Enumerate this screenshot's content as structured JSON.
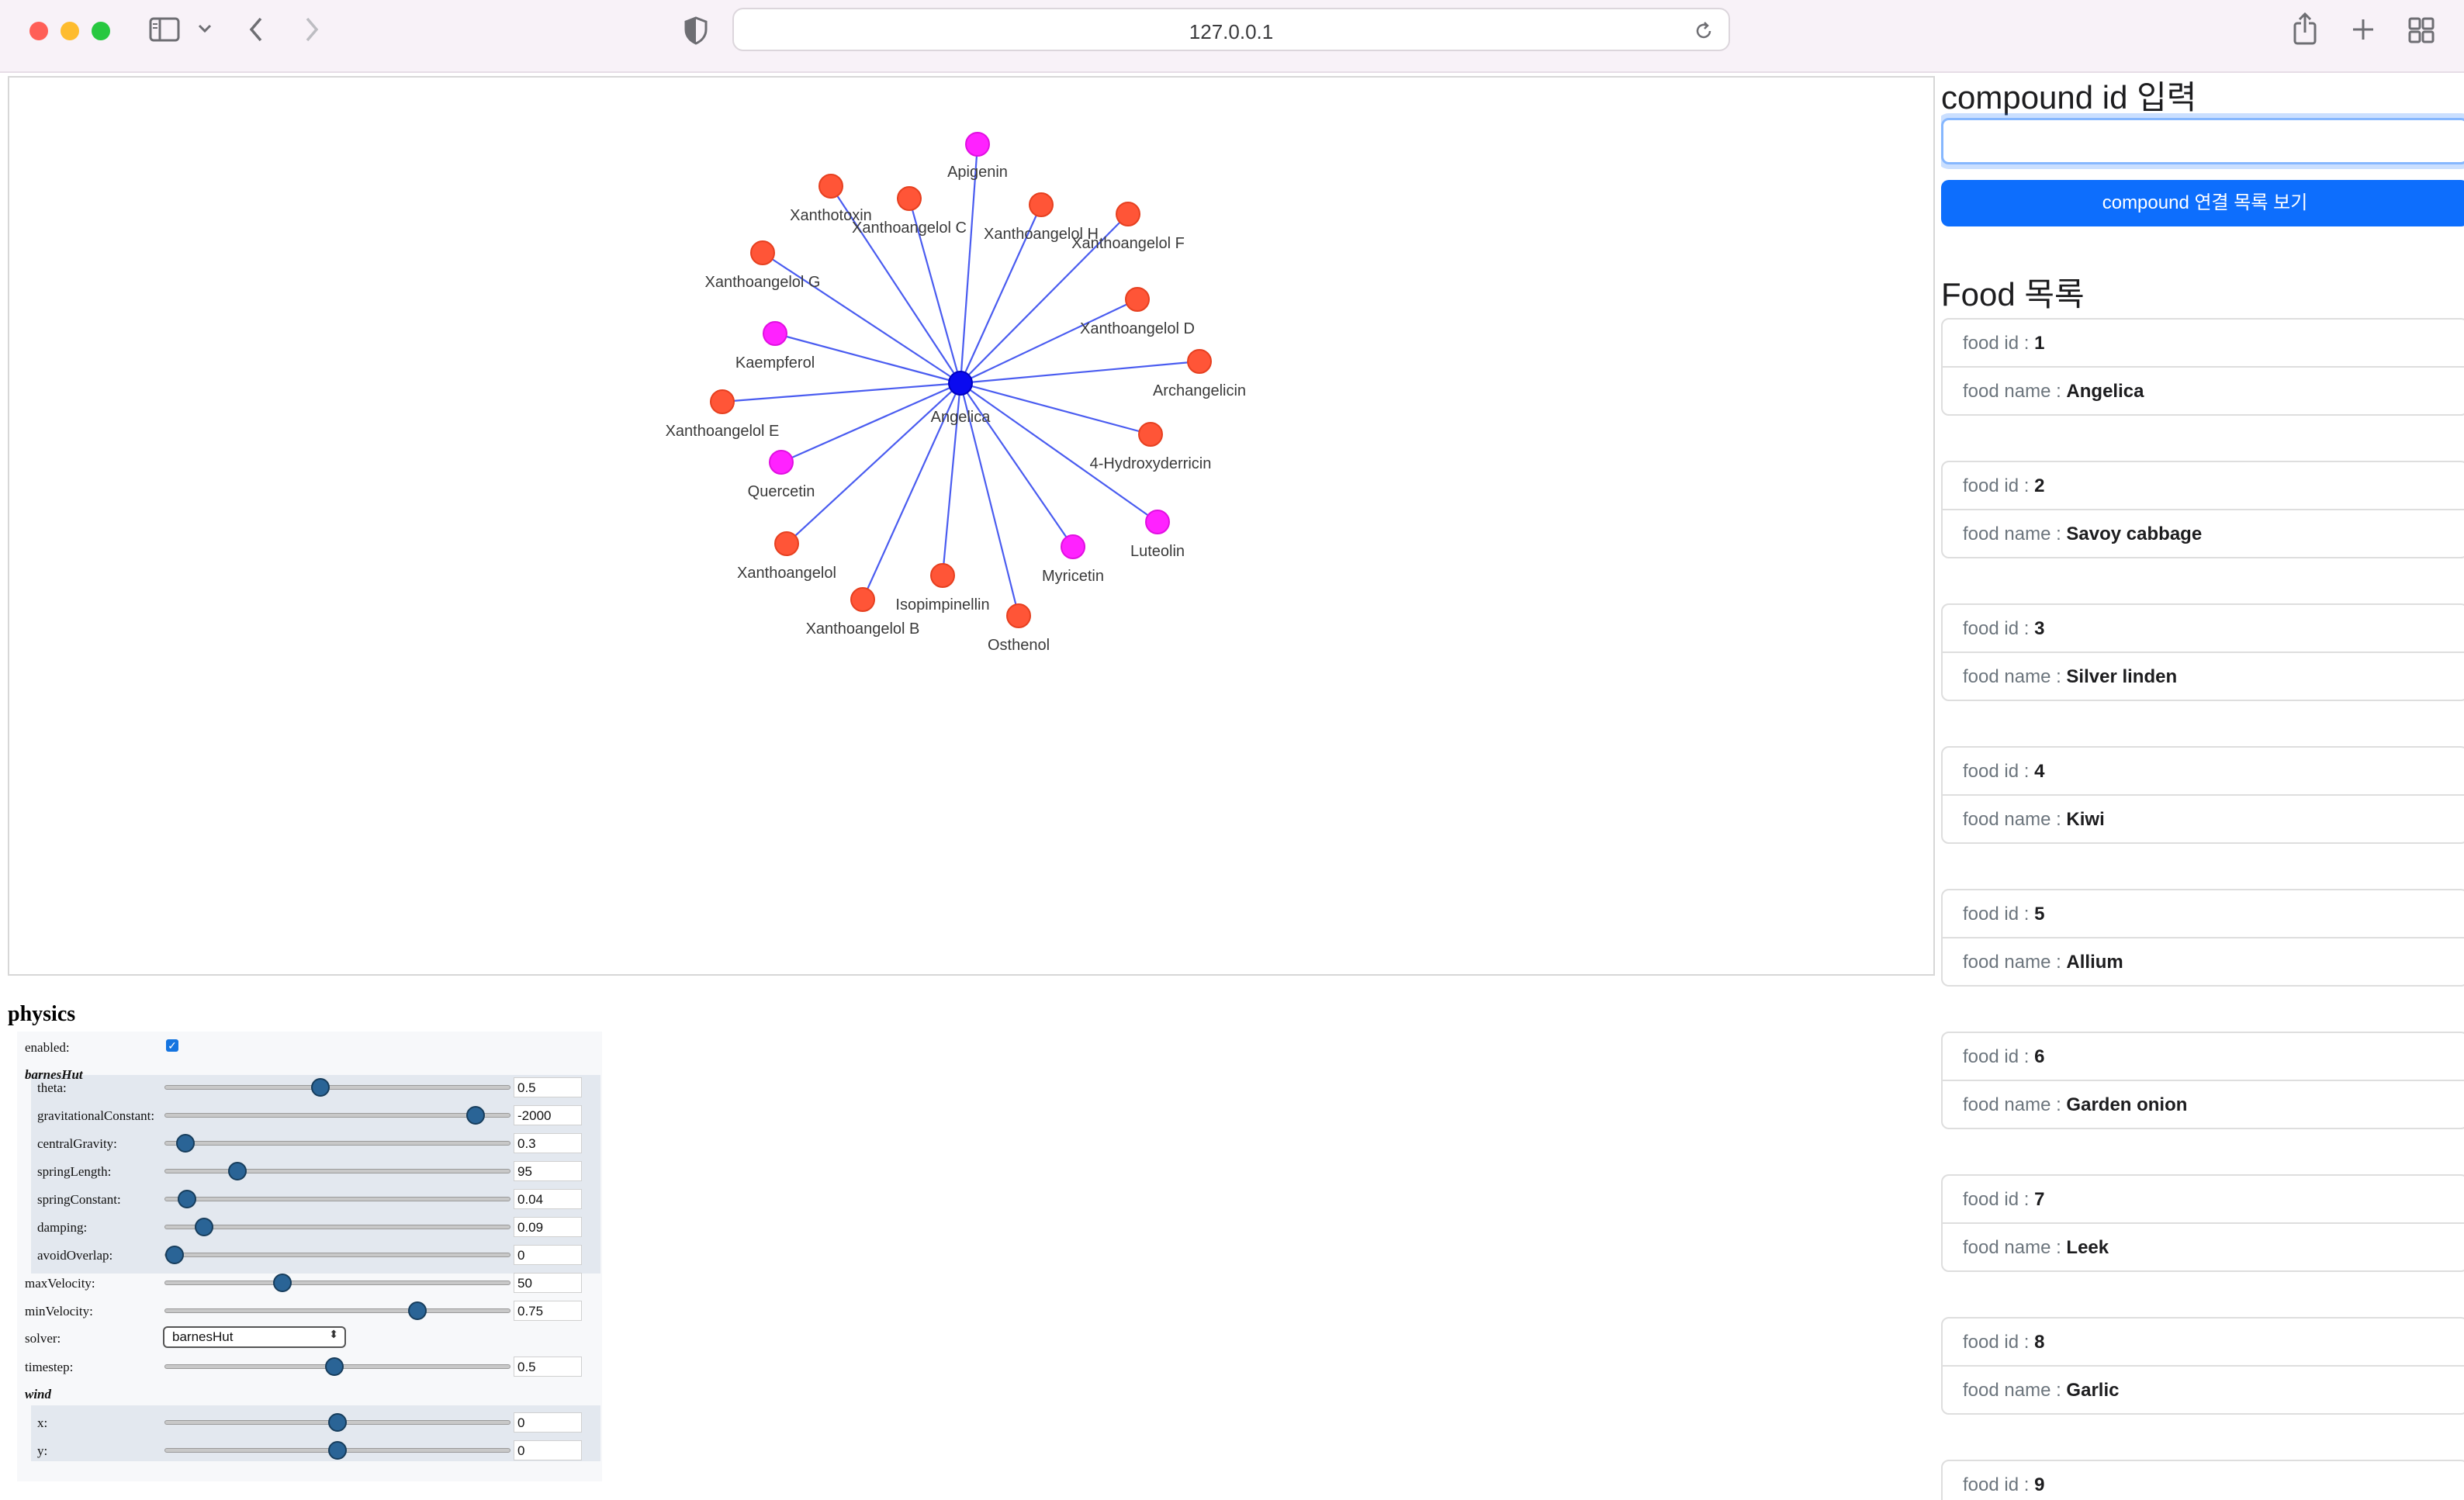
{
  "browser": {
    "url": "127.0.0.1"
  },
  "graph": {
    "center": {
      "label": "Angelica",
      "color": "#0a0af0"
    },
    "edge_color": "#4a5cf0",
    "label_color": "#3a3a3a",
    "nodes": [
      {
        "label": "Apigenin",
        "color": "#ff22ff"
      },
      {
        "label": "Xanthoangelol H",
        "color": "#ff5537"
      },
      {
        "label": "Xanthoangelol F",
        "color": "#ff5537"
      },
      {
        "label": "Xanthoangelol D",
        "color": "#ff5537"
      },
      {
        "label": "Archangelicin",
        "color": "#ff5537"
      },
      {
        "label": "4-Hydroxyderricin",
        "color": "#ff5537"
      },
      {
        "label": "Luteolin",
        "color": "#ff22ff"
      },
      {
        "label": "Myricetin",
        "color": "#ff22ff"
      },
      {
        "label": "Osthenol",
        "color": "#ff5537"
      },
      {
        "label": "Isopimpinellin",
        "color": "#ff5537"
      },
      {
        "label": "Xanthoangelol B",
        "color": "#ff5537"
      },
      {
        "label": "Xanthoangelol",
        "color": "#ff5537"
      },
      {
        "label": "Quercetin",
        "color": "#ff22ff"
      },
      {
        "label": "Xanthoangelol E",
        "color": "#ff5537"
      },
      {
        "label": "Kaempferol",
        "color": "#ff22ff"
      },
      {
        "label": "Xanthoangelol G",
        "color": "#ff5537"
      },
      {
        "label": "Xanthotoxin",
        "color": "#ff5537"
      },
      {
        "label": "Xanthoangelol C",
        "color": "#ff5537"
      }
    ]
  },
  "physics": {
    "title": "physics",
    "enabled_label": "enabled:",
    "barnes_hut_label": "barnesHut",
    "wind_label": "wind",
    "params": [
      {
        "label": "theta:",
        "value": "0.5",
        "level": 0.45
      },
      {
        "label": "gravitationalConstant:",
        "value": "-2000",
        "level": 0.9
      },
      {
        "label": "centralGravity:",
        "value": "0.3",
        "level": 0.06
      },
      {
        "label": "springLength:",
        "value": "95",
        "level": 0.21
      },
      {
        "label": "springConstant:",
        "value": "0.04",
        "level": 0.065
      },
      {
        "label": "damping:",
        "value": "0.09",
        "level": 0.115
      },
      {
        "label": "avoidOverlap:",
        "value": "0",
        "level": 0.03
      },
      {
        "label": "maxVelocity:",
        "value": "50",
        "level": 0.34
      },
      {
        "label": "minVelocity:",
        "value": "0.75",
        "level": 0.73
      }
    ],
    "solver_label": "solver:",
    "solver_value": "barnesHut",
    "timestep": {
      "label": "timestep:",
      "value": "0.5",
      "level": 0.49
    },
    "wind": [
      {
        "label": "x:",
        "value": "0",
        "level": 0.5
      },
      {
        "label": "y:",
        "value": "0",
        "level": 0.5
      }
    ]
  },
  "sidebar": {
    "compound_heading": "compound id 입력",
    "input_value": "",
    "button_label": "compound 연결 목록 보기",
    "food_heading": "Food 목록",
    "id_label": "food id : ",
    "name_label": "food name : ",
    "foods": [
      {
        "id": "1",
        "name": "Angelica"
      },
      {
        "id": "2",
        "name": "Savoy cabbage"
      },
      {
        "id": "3",
        "name": "Silver linden"
      },
      {
        "id": "4",
        "name": "Kiwi"
      },
      {
        "id": "5",
        "name": "Allium"
      },
      {
        "id": "6",
        "name": "Garden onion"
      },
      {
        "id": "7",
        "name": "Leek"
      },
      {
        "id": "8",
        "name": "Garlic"
      },
      {
        "id": "9",
        "name": ""
      }
    ]
  }
}
